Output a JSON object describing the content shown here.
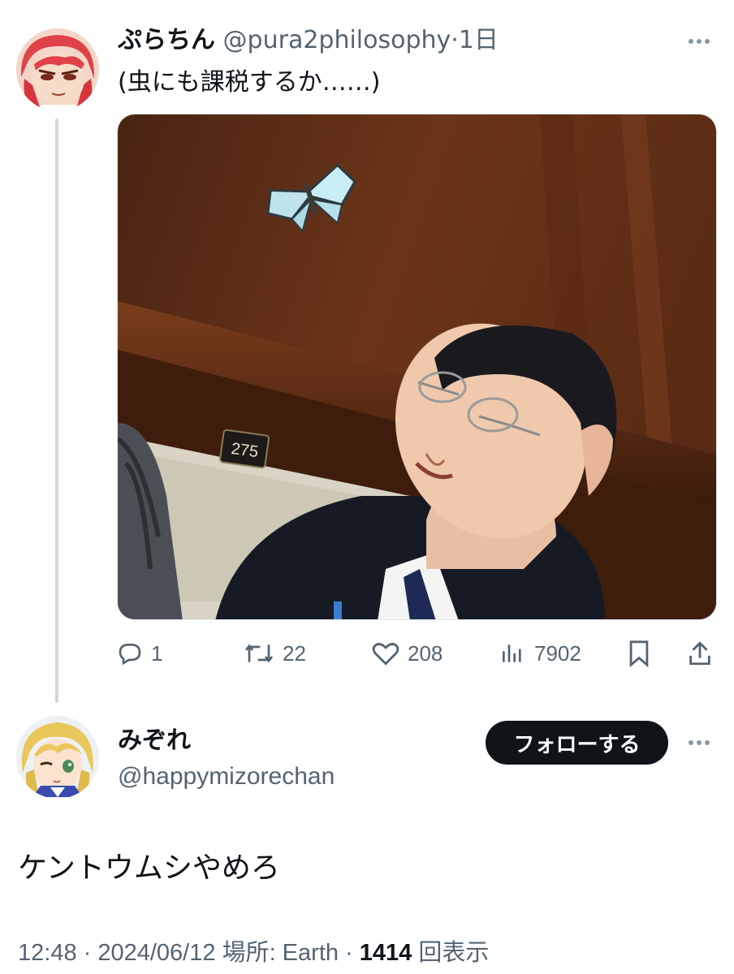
{
  "tweet1": {
    "display_name": "ぷらちん",
    "handle": "@pura2philosophy",
    "separator": "·",
    "time": "1日",
    "text": "(虫にも課税するか……)",
    "image_placard": "275",
    "stats": {
      "replies": "1",
      "retweets": "22",
      "likes": "208",
      "views": "7902"
    }
  },
  "tweet2": {
    "display_name": "みぞれ",
    "handle": "@happymizorechan",
    "follow_label": "フォローする",
    "text": "ケントウムシやめろ",
    "meta": {
      "time": "12:48",
      "sep1": " · ",
      "date": "2024/06/12",
      "location": " 場所: Earth",
      "sep2": " · ",
      "views": "1414",
      "views_suffix": " 回表示"
    }
  },
  "colors": {
    "text": "#0f1419",
    "secondary": "#536471",
    "thread_line": "#cfd9de",
    "button_bg": "#0f1419"
  }
}
